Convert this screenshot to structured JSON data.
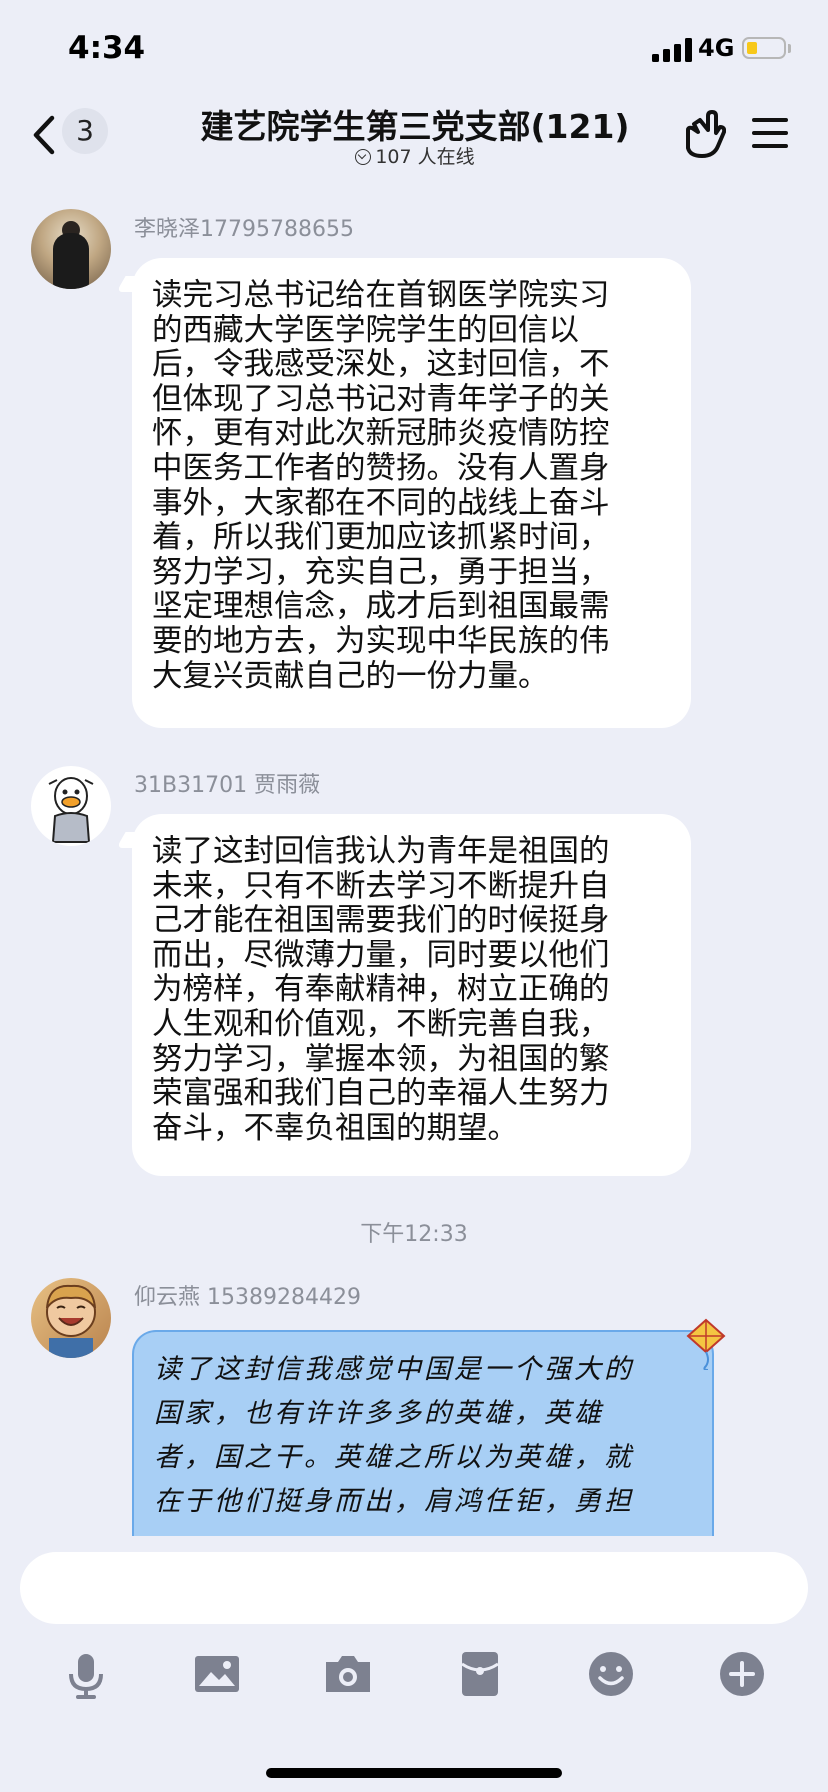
{
  "status": {
    "time": "4:34",
    "network": "4G"
  },
  "header": {
    "back_count": "3",
    "title": "建艺院学生第三党支部(121)",
    "online": "107 人在线"
  },
  "messages": [
    {
      "sender": "李晓泽17795788655",
      "text": "读完习总书记给在首钢医学院实习\n的西藏大学医学院学生的回信以\n后，令我感受深处，这封回信，不\n但体现了习总书记对青年学子的关\n怀，更有对此次新冠肺炎疫情防控\n中医务工作者的赞扬。没有人置身\n事外，大家都在不同的战线上奋斗\n着，所以我们更加应该抓紧时间，\n努力学习，充实自己，勇于担当，\n坚定理想信念，成才后到祖国最需\n要的地方去，为实现中华民族的伟\n大复兴贡献自己的一份力量。"
    },
    {
      "sender": "31B31701 贾雨薇",
      "text": "读了这封回信我认为青年是祖国的\n未来，只有不断去学习不断提升自\n己才能在祖国需要我们的时候挺身\n而出，尽微薄力量，同时要以他们\n为榜样，有奉献精神，树立正确的\n人生观和价值观，不断完善自我，\n努力学习，掌握本领，为祖国的繁\n荣富强和我们自己的幸福人生努力\n奋斗，不辜负祖国的期望。"
    },
    {
      "sender": "仰云燕 15389284429",
      "text": "读了这封信我感觉中国是一个强大的\n国家，也有许许多多的英雄，英雄\n者，国之干。英雄之所以为英雄，就\n在于他们挺身而出，肩鸿任钜，勇担"
    }
  ],
  "timestamp": "下午12:33",
  "input": {
    "placeholder": ""
  },
  "toolbar": [
    "mic-icon",
    "image-icon",
    "camera-icon",
    "red-packet-icon",
    "emoji-icon",
    "plus-icon"
  ],
  "colors": {
    "background": "#eceef7",
    "bubble": "#ffffff",
    "theme_bubble": "#a8cff5",
    "meta_text": "#8b8f99"
  }
}
